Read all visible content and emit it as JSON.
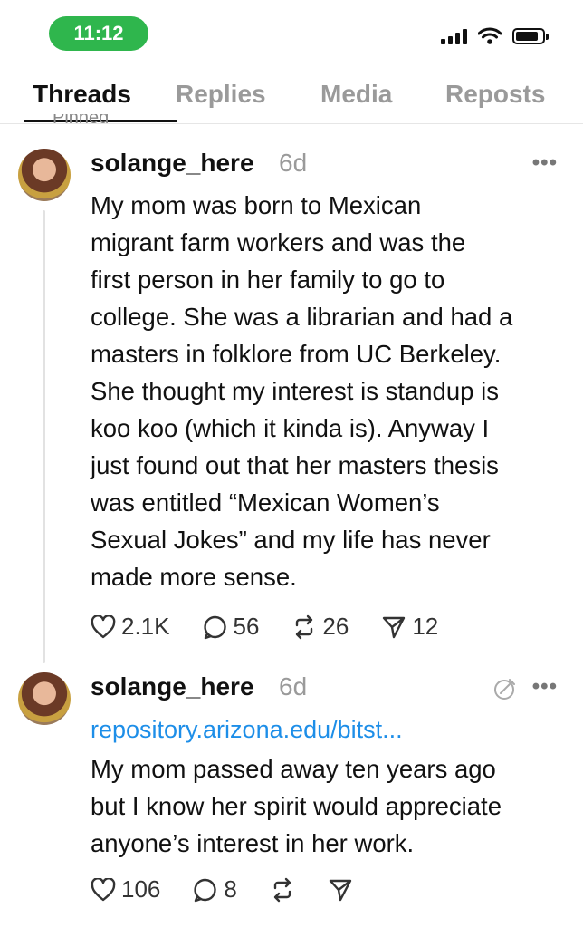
{
  "status_bar": {
    "time": "11:12"
  },
  "tabs": [
    {
      "label": "Threads",
      "active": true
    },
    {
      "label": "Replies",
      "active": false
    },
    {
      "label": "Media",
      "active": false
    },
    {
      "label": "Reposts",
      "active": false
    }
  ],
  "pinned_label": "Pinned",
  "posts": [
    {
      "username": "solange_here",
      "age": "6d",
      "text_lines": [
        "My mom was born to Mexican",
        "migrant farm workers and was the",
        "first person in her family to go to",
        "college. She was a librarian and had a",
        "masters in folklore from UC Berkeley.",
        "She thought my interest is standup is",
        "koo koo (which it kinda is). Anyway I",
        "just found out that her masters thesis",
        "was entitled “Mexican Women’s",
        "Sexual Jokes” and my life has never",
        "made more sense."
      ],
      "likes": "2.1K",
      "replies": "56",
      "reposts": "26",
      "shares": "12"
    },
    {
      "username": "solange_here",
      "age": "6d",
      "link": "repository.arizona.edu/bitst...",
      "text_lines": [
        "My mom passed away ten years ago",
        "but I know her spirit would appreciate",
        "anyone’s interest in her work."
      ],
      "likes": "106",
      "replies": "8"
    }
  ],
  "colors": {
    "time_pill": "#2fb64d",
    "link": "#1d8ee8",
    "muted": "#9a9a9a"
  }
}
